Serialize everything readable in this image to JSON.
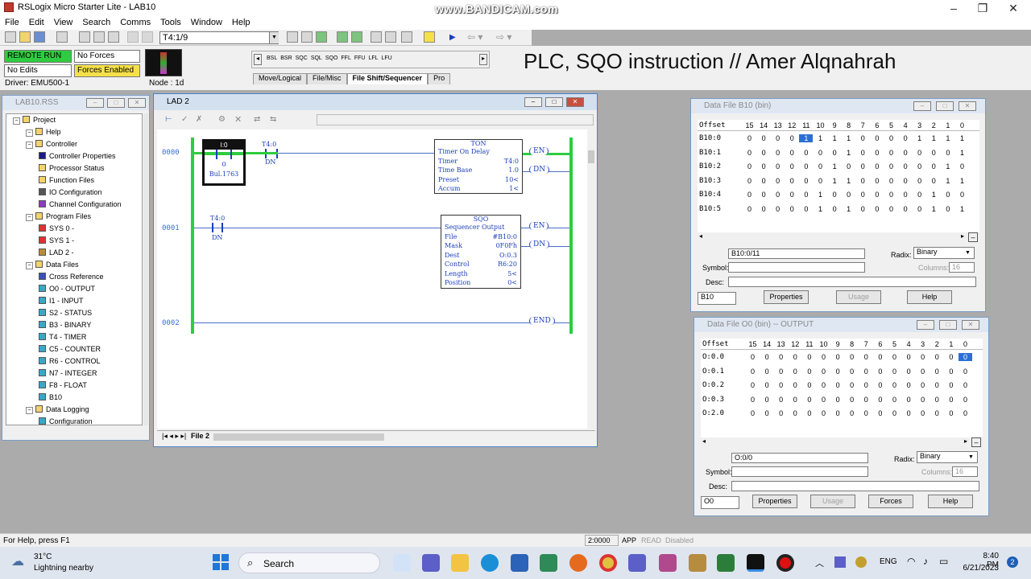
{
  "app": {
    "title": "RSLogix Micro Starter Lite - LAB10",
    "watermark": "www.BANDICAM.com",
    "video_title": "PLC, SQO instruction // Amer Alqnahrah"
  },
  "menu": [
    "File",
    "Edit",
    "View",
    "Search",
    "Comms",
    "Tools",
    "Window",
    "Help"
  ],
  "toolbar": {
    "address": "T4:1/9"
  },
  "status_panel": {
    "mode": "REMOTE RUN",
    "forces": "No Forces",
    "edits": "No Edits",
    "forces_enabled": "Forces Enabled",
    "driver": "Driver: EMU500-1",
    "node": "Node : 1d"
  },
  "instr_palette": {
    "items": [
      "BSL",
      "BSR",
      "SQC",
      "SQL",
      "SQO",
      "FFL",
      "FFU",
      "LFL",
      "LFU"
    ],
    "tabs": [
      "Move/Logical",
      "File/Misc",
      "File Shift/Sequencer",
      "Pro"
    ]
  },
  "project_tree": {
    "title": "LAB10.RSS",
    "items": [
      {
        "label": "Project",
        "level": 0,
        "icon": "folder"
      },
      {
        "label": "Help",
        "level": 1,
        "icon": "folder"
      },
      {
        "label": "Controller",
        "level": 1,
        "icon": "folder"
      },
      {
        "label": "Controller Properties",
        "level": 2,
        "icon": "info"
      },
      {
        "label": "Processor Status",
        "level": 2,
        "icon": "tag"
      },
      {
        "label": "Function Files",
        "level": 2,
        "icon": "tag"
      },
      {
        "label": "IO Configuration",
        "level": 2,
        "icon": "io"
      },
      {
        "label": "Channel Configuration",
        "level": 2,
        "icon": "channel"
      },
      {
        "label": "Program Files",
        "level": 1,
        "icon": "folder"
      },
      {
        "label": "SYS 0 -",
        "level": 2,
        "icon": "sys"
      },
      {
        "label": "SYS 1 -",
        "level": 2,
        "icon": "sys"
      },
      {
        "label": "LAD 2 -",
        "level": 2,
        "icon": "lad"
      },
      {
        "label": "Data Files",
        "level": 1,
        "icon": "folder"
      },
      {
        "label": "Cross Reference",
        "level": 2,
        "icon": "xref"
      },
      {
        "label": "O0 - OUTPUT",
        "level": 2,
        "icon": "doc"
      },
      {
        "label": "I1 - INPUT",
        "level": 2,
        "icon": "doc"
      },
      {
        "label": "S2 - STATUS",
        "level": 2,
        "icon": "doc"
      },
      {
        "label": "B3 - BINARY",
        "level": 2,
        "icon": "doc"
      },
      {
        "label": "T4 - TIMER",
        "level": 2,
        "icon": "doc"
      },
      {
        "label": "C5 - COUNTER",
        "level": 2,
        "icon": "doc"
      },
      {
        "label": "R6 - CONTROL",
        "level": 2,
        "icon": "doc"
      },
      {
        "label": "N7 - INTEGER",
        "level": 2,
        "icon": "doc"
      },
      {
        "label": "F8 - FLOAT",
        "level": 2,
        "icon": "doc"
      },
      {
        "label": "B10",
        "level": 2,
        "icon": "doc"
      },
      {
        "label": "Data Logging",
        "level": 1,
        "icon": "folder"
      },
      {
        "label": "Configuration",
        "level": 2,
        "icon": "doc"
      }
    ]
  },
  "ladder": {
    "title": "LAD 2",
    "tab": "File 2",
    "rungs": [
      {
        "num": "0000",
        "contacts": [
          {
            "addr": "I:0",
            "bit": "0",
            "desc": "Bul.1763"
          },
          {
            "addr": "T4:0",
            "bit": "DN"
          }
        ],
        "instr": {
          "name": "TON",
          "desc": "Timer On Delay",
          "rows": [
            [
              "Timer",
              "T4:0"
            ],
            [
              "Time Base",
              "1.0"
            ],
            [
              "Preset",
              "10<"
            ],
            [
              "Accum",
              "1<"
            ]
          ]
        },
        "coils": [
          "EN",
          "DN"
        ]
      },
      {
        "num": "0001",
        "contacts": [
          {
            "addr": "T4:0",
            "bit": "DN"
          }
        ],
        "instr": {
          "name": "SQO",
          "desc": "Sequencer Output",
          "rows": [
            [
              "File",
              "#B10:0"
            ],
            [
              "Mask",
              "0F0Fh"
            ],
            [
              "Dest",
              "O:0.3"
            ],
            [
              "Control",
              "R6:20"
            ],
            [
              "Length",
              "5<"
            ],
            [
              "Position",
              "0<"
            ]
          ]
        },
        "coils": [
          "EN",
          "DN"
        ]
      },
      {
        "num": "0002",
        "end": "END"
      }
    ]
  },
  "b10": {
    "title": "Data File B10 (bin)",
    "header_offset": "Offset",
    "bits": [
      "15",
      "14",
      "13",
      "12",
      "11",
      "10",
      "9",
      "8",
      "7",
      "6",
      "5",
      "4",
      "3",
      "2",
      "1",
      "0"
    ],
    "rows": [
      {
        "offset": "B10:0",
        "values": [
          "0",
          "0",
          "0",
          "0",
          "1",
          "1",
          "1",
          "1",
          "0",
          "0",
          "0",
          "0",
          "1",
          "1",
          "1",
          "1"
        ]
      },
      {
        "offset": "B10:1",
        "values": [
          "0",
          "0",
          "0",
          "0",
          "0",
          "0",
          "0",
          "1",
          "0",
          "0",
          "0",
          "0",
          "0",
          "0",
          "0",
          "1"
        ]
      },
      {
        "offset": "B10:2",
        "values": [
          "0",
          "0",
          "0",
          "0",
          "0",
          "0",
          "1",
          "0",
          "0",
          "0",
          "0",
          "0",
          "0",
          "0",
          "1",
          "0"
        ]
      },
      {
        "offset": "B10:3",
        "values": [
          "0",
          "0",
          "0",
          "0",
          "0",
          "0",
          "1",
          "1",
          "0",
          "0",
          "0",
          "0",
          "0",
          "0",
          "1",
          "1"
        ]
      },
      {
        "offset": "B10:4",
        "values": [
          "0",
          "0",
          "0",
          "0",
          "0",
          "1",
          "0",
          "0",
          "0",
          "0",
          "0",
          "0",
          "0",
          "1",
          "0",
          "0"
        ]
      },
      {
        "offset": "B10:5",
        "values": [
          "0",
          "0",
          "0",
          "0",
          "0",
          "1",
          "0",
          "1",
          "0",
          "0",
          "0",
          "0",
          "0",
          "1",
          "0",
          "1"
        ]
      }
    ],
    "address_field": "B10:0/11",
    "radix_label": "Radix:",
    "radix_value": "Binary",
    "symbol_label": "Symbol:",
    "desc_label": "Desc:",
    "columns_label": "Columns:",
    "columns_value": "16",
    "file_select": "B10",
    "btn_properties": "Properties",
    "btn_usage": "Usage",
    "btn_help": "Help"
  },
  "o0": {
    "title": "Data File O0 (bin) -- OUTPUT",
    "header_offset": "Offset",
    "bits": [
      "15",
      "14",
      "13",
      "12",
      "11",
      "10",
      "9",
      "8",
      "7",
      "6",
      "5",
      "4",
      "3",
      "2",
      "1",
      "0"
    ],
    "rows": [
      {
        "offset": "O:0.0",
        "values": [
          "0",
          "0",
          "0",
          "0",
          "0",
          "0",
          "0",
          "0",
          "0",
          "0",
          "0",
          "0",
          "0",
          "0",
          "0",
          "0"
        ]
      },
      {
        "offset": "O:0.1",
        "values": [
          "0",
          "0",
          "0",
          "0",
          "0",
          "0",
          "0",
          "0",
          "0",
          "0",
          "0",
          "0",
          "0",
          "0",
          "0",
          "0"
        ]
      },
      {
        "offset": "O:0.2",
        "values": [
          "0",
          "0",
          "0",
          "0",
          "0",
          "0",
          "0",
          "0",
          "0",
          "0",
          "0",
          "0",
          "0",
          "0",
          "0",
          "0"
        ]
      },
      {
        "offset": "O:0.3",
        "values": [
          "0",
          "0",
          "0",
          "0",
          "0",
          "0",
          "0",
          "0",
          "0",
          "0",
          "0",
          "0",
          "0",
          "0",
          "0",
          "0"
        ]
      },
      {
        "offset": "O:2.0",
        "values": [
          "0",
          "0",
          "0",
          "0",
          "0",
          "0",
          "0",
          "0",
          "0",
          "0",
          "0",
          "0",
          "0",
          "0",
          "0",
          "0"
        ]
      }
    ],
    "address_field": "O:0/0",
    "radix_label": "Radix:",
    "radix_value": "Binary",
    "symbol_label": "Symbol:",
    "desc_label": "Desc:",
    "columns_label": "Columns:",
    "columns_value": "16",
    "file_select": "O0",
    "btn_properties": "Properties",
    "btn_usage": "Usage",
    "btn_forces": "Forces",
    "btn_help": "Help"
  },
  "statusbar": {
    "help": "For Help, press F1",
    "addr": "2:0000",
    "app": "APP",
    "read": "READ",
    "disabled": "Disabled"
  },
  "taskbar": {
    "weather_temp": "31°C",
    "weather_desc": "Lightning nearby",
    "search": "Search",
    "lang": "ENG",
    "time": "8:40 PM",
    "date": "6/21/2023",
    "notif": "2"
  }
}
